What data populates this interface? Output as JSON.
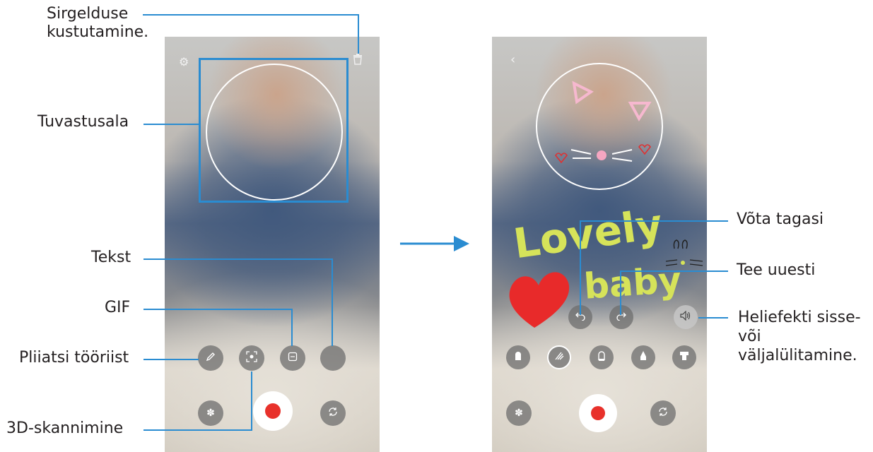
{
  "callouts_left": {
    "delete_drawing": "Sirgelduse\nkustutamine.",
    "detection_area": "Tuvastusala",
    "text": "Tekst",
    "gif": "GIF",
    "pen_tool": "Pliiatsi tööriist",
    "scan_3d": "3D-skannimine"
  },
  "callouts_right": {
    "undo": "Võta tagasi",
    "redo": "Tee uuesti",
    "sound_effect": "Heliefekti sisse-\nvõi\nväljalülitamine."
  },
  "drawing_text": {
    "word1": "Lovely",
    "word2": "baby"
  },
  "colors": {
    "callout_line": "#2a8cd1",
    "record_dot": "#e8312b",
    "scribble": "#d6e35a"
  },
  "icons": {
    "settings": "gear-icon",
    "delete": "trash-icon",
    "back": "chevron-left-icon",
    "pen": "pen-icon",
    "scan": "scan-3d-icon",
    "gif": "gif-icon",
    "effects": "flower-icon",
    "switch_camera": "switch-camera-icon",
    "undo": "undo-icon",
    "redo": "redo-icon",
    "sound": "speaker-icon"
  }
}
